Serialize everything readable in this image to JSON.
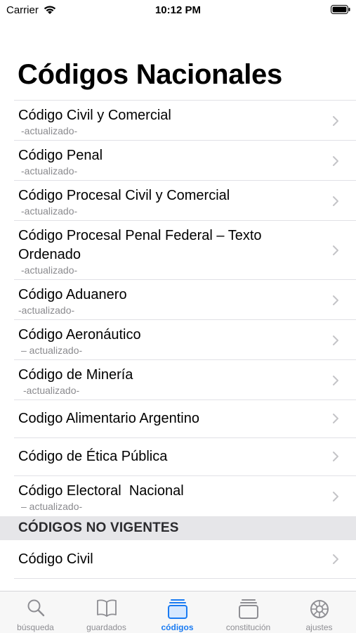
{
  "status": {
    "carrier": "Carrier",
    "time": "10:12 PM"
  },
  "title": "Códigos Nacionales",
  "codes": [
    {
      "title": "Código Civil y Comercial",
      "subtitle": "-actualizado-"
    },
    {
      "title": "Código Penal",
      "subtitle": "-actualizado-"
    },
    {
      "title": "Código Procesal Civil y Comercial",
      "subtitle": "-actualizado-"
    },
    {
      "title": "Código Procesal Penal Federal – Texto Ordenado",
      "subtitle": "-actualizado-"
    },
    {
      "title": "Código Aduanero",
      "subtitle": "-actualizado-"
    },
    {
      "title": "Código Aeronáutico",
      "subtitle": "– actualizado-"
    },
    {
      "title": "Código de Minería",
      "subtitle": "-actualizado-"
    },
    {
      "title": "Codigo Alimentario Argentino",
      "subtitle": ""
    },
    {
      "title": "Código de Ética Pública",
      "subtitle": ""
    },
    {
      "title": "Código Electoral  Nacional",
      "subtitle": "– actualizado-"
    }
  ],
  "section_header": "CÓDIGOS NO VIGENTES",
  "old_codes": [
    {
      "title": "Código Civil",
      "subtitle": ""
    }
  ],
  "tabs": [
    {
      "label": "búsqueda",
      "icon": "search-icon"
    },
    {
      "label": "guardados",
      "icon": "book-icon"
    },
    {
      "label": "códigos",
      "icon": "stacked-pages-icon",
      "active": true
    },
    {
      "label": "constitución",
      "icon": "stacked-pages-icon"
    },
    {
      "label": "ajustes",
      "icon": "gear-icon"
    }
  ],
  "colors": {
    "accent": "#1a7bf2",
    "inactive": "#8e8e93",
    "section_bg": "#e6e6e9"
  }
}
